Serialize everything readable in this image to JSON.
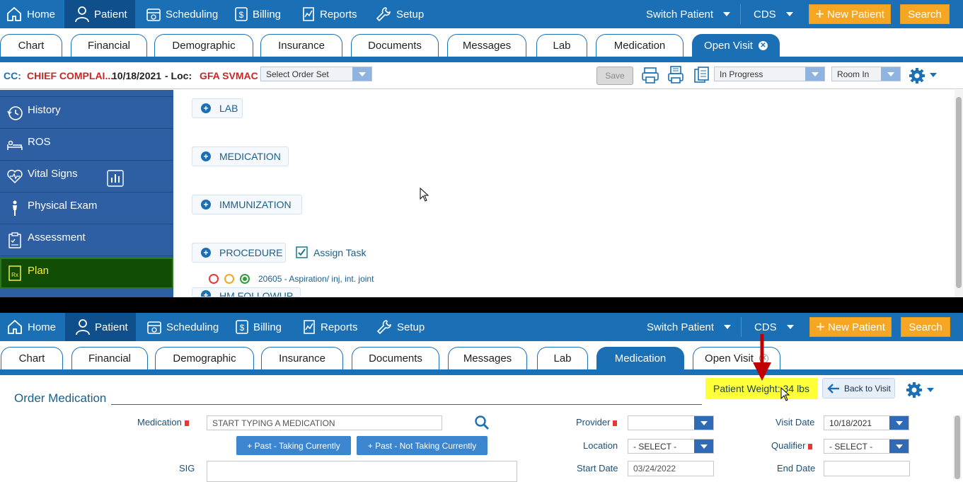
{
  "top": {
    "nav": {
      "home": "Home",
      "patient": "Patient",
      "scheduling": "Scheduling",
      "billing": "Billing",
      "reports": "Reports",
      "setup": "Setup",
      "switch_patient": "Switch Patient",
      "cds": "CDS",
      "new_patient": "New Patient",
      "search": "Search"
    },
    "tabs": [
      "Chart",
      "Financial",
      "Demographic",
      "Insurance",
      "Documents",
      "Messages",
      "Lab",
      "Medication",
      "Open Visit"
    ],
    "infobar": {
      "cc_label": "CC:",
      "cc_value": "CHIEF COMPLAI...",
      "date": "10/18/2021",
      "loc_label": "- Loc:",
      "loc_value": "GFA SVMAC",
      "order_set_placeholder": "Select Order Set",
      "save": "Save",
      "status": "In Progress",
      "room": "Room In"
    },
    "sidebar": [
      {
        "label": "History",
        "icon": "history-icon"
      },
      {
        "label": "ROS",
        "icon": "bed-icon"
      },
      {
        "label": "Vital Signs",
        "icon": "heart-pulse-icon"
      },
      {
        "label": "Physical Exam",
        "icon": "person-icon"
      },
      {
        "label": "Assessment",
        "icon": "clipboard-icon"
      },
      {
        "label": "Plan",
        "icon": "rx-icon"
      }
    ],
    "sections": {
      "lab": "LAB",
      "medication": "MEDICATION",
      "immunization": "IMMUNIZATION",
      "procedure": "PROCEDURE",
      "assign_task": "Assign Task",
      "procedure_item": "20605 - Aspiration/ inj, int. joint",
      "partial_section": "HM FOLLOWUP"
    }
  },
  "bottom": {
    "nav": {
      "home": "Home",
      "patient": "Patient",
      "scheduling": "Scheduling",
      "billing": "Billing",
      "reports": "Reports",
      "setup": "Setup",
      "switch_patient": "Switch Patient",
      "cds": "CDS",
      "new_patient": "New Patient",
      "search": "Search"
    },
    "tabs": [
      "Chart",
      "Financial",
      "Demographic",
      "Insurance",
      "Documents",
      "Messages",
      "Lab",
      "Medication",
      "Open Visit"
    ],
    "order_medication": {
      "title": "Order Medication",
      "patient_weight": "Patient Weight: 34 lbs",
      "back_to_visit": "Back to Visit",
      "medication_label": "Medication",
      "medication_placeholder": "START TYPING A MEDICATION",
      "past_taking": "+ Past - Taking Currently",
      "past_not_taking": "+ Past - Not Taking Currently",
      "sig_label": "SIG",
      "provider_label": "Provider",
      "location_label": "Location",
      "location_value": "- SELECT -",
      "start_date_label": "Start Date",
      "start_date_value": "03/24/2022",
      "visit_date_label": "Visit Date",
      "visit_date_value": "10/18/2021",
      "qualifier_label": "Qualifier",
      "qualifier_value": "- SELECT -",
      "end_date_label": "End Date"
    }
  },
  "colors": {
    "nav_blue": "#1a6fb5",
    "orange": "#f5a623",
    "highlight_yellow": "#ffff3a",
    "annotation_red": "#c00000"
  }
}
